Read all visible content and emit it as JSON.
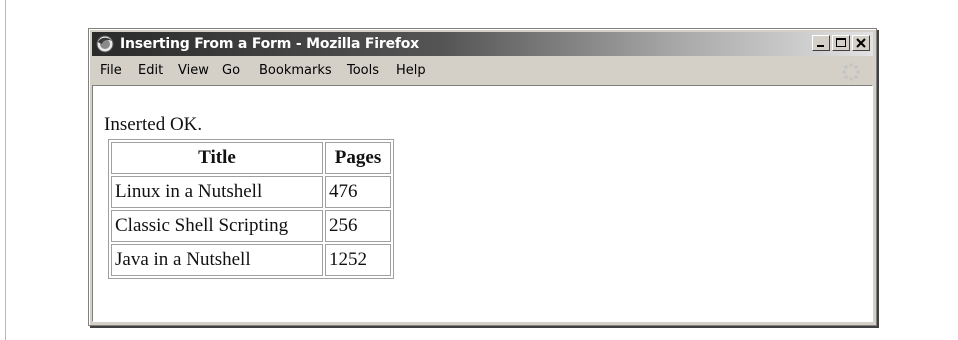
{
  "window": {
    "title": "Inserting From a Form - Mozilla Firefox",
    "app_icon": "firefox-icon",
    "buttons": [
      "minimize-icon",
      "maximize-icon",
      "close-icon"
    ]
  },
  "menubar": {
    "items": [
      {
        "label": "File"
      },
      {
        "label": "Edit"
      },
      {
        "label": "View"
      },
      {
        "label": "Go"
      },
      {
        "label": "Bookmarks"
      },
      {
        "label": "Tools"
      },
      {
        "label": "Help"
      }
    ],
    "throbber_icon": "throbber-icon"
  },
  "content": {
    "message": "Inserted OK.",
    "table": {
      "headers": [
        "Title",
        "Pages"
      ],
      "rows": [
        [
          "Linux in a Nutshell",
          "476"
        ],
        [
          "Classic Shell Scripting",
          "256"
        ],
        [
          "Java in a Nutshell",
          "1252"
        ]
      ]
    }
  }
}
